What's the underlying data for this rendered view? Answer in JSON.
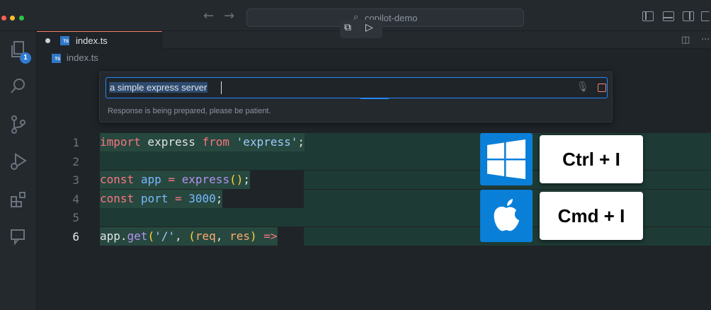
{
  "titlebar": {
    "back_glyph": "←",
    "forward_glyph": "→",
    "search_glyph": "⌕",
    "command_center": "copilot-demo",
    "float_tool_1": "⧉",
    "float_tool_2": "▷"
  },
  "activity": {
    "explorer_badge": "1",
    "icons": [
      "files-icon",
      "search-icon",
      "source-control-icon",
      "run-debug-icon",
      "extensions-icon",
      "chat-icon"
    ]
  },
  "tabs": [
    {
      "label": "index.ts",
      "icon": "ts-file-icon",
      "modified": true
    }
  ],
  "tab_actions": {
    "split": "◫",
    "more": "···"
  },
  "breadcrumb": {
    "file": "index.ts"
  },
  "inline_chat": {
    "input_value": "a simple express server",
    "status": "Response is being prepared, please be patient.",
    "mic_glyph": "🎙"
  },
  "editor": {
    "line_numbers": [
      "1",
      "2",
      "3",
      "4",
      "5",
      "6"
    ],
    "active_line": "6"
  },
  "shortcuts": {
    "windows": "Ctrl + I",
    "mac": "Cmd + I"
  },
  "colors": {
    "accent": "#2188ff",
    "tab_border": "#f9826c",
    "badge": "#2f7bd1",
    "os_tile": "#0a7fd8"
  }
}
